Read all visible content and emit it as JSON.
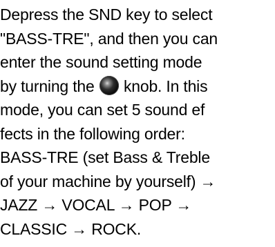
{
  "document": {
    "lines": [
      "Depress the SND key to select",
      "\"BASS-TRE\", and then you can",
      "enter the sound setting mode",
      {
        "before": "by turning the ",
        "after": " knob. In this"
      },
      "mode, you can set 5 sound ef",
      "fects in the following order:",
      "BASS-TRE (set Bass & Treble",
      "of your machine by yourself) →",
      "JAZZ → VOCAL → POP →",
      "CLASSIC → ROCK."
    ],
    "icons": {
      "knob": "knob-icon"
    }
  }
}
